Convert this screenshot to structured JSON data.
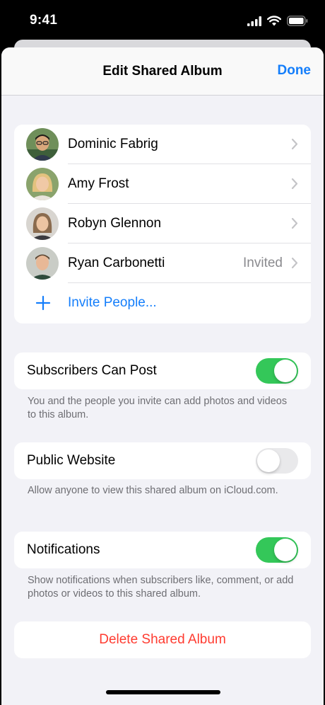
{
  "status_bar": {
    "time": "9:41"
  },
  "nav": {
    "title": "Edit Shared Album",
    "done_label": "Done"
  },
  "people": [
    {
      "name": "Dominic Fabrig",
      "detail": "",
      "avatar": "dominic-avatar"
    },
    {
      "name": "Amy Frost",
      "detail": "",
      "avatar": "amy-avatar"
    },
    {
      "name": "Robyn Glennon",
      "detail": "",
      "avatar": "robyn-avatar"
    },
    {
      "name": "Ryan Carbonetti",
      "detail": "Invited",
      "avatar": "ryan-avatar"
    }
  ],
  "invite": {
    "label": "Invite People..."
  },
  "settings": {
    "subscribers_can_post": {
      "label": "Subscribers Can Post",
      "on": true,
      "footnote": "You and the people you invite can add photos and videos to this album."
    },
    "public_website": {
      "label": "Public Website",
      "on": false,
      "footnote": "Allow anyone to view this shared album on iCloud.com."
    },
    "notifications": {
      "label": "Notifications",
      "on": true,
      "footnote": "Show notifications when subscribers like, comment, or add photos or videos to this shared album."
    }
  },
  "delete": {
    "label": "Delete Shared Album"
  },
  "colors": {
    "accent": "#147efb",
    "switch_on": "#34c759",
    "destructive": "#ff3b30",
    "background": "#f2f2f7"
  }
}
